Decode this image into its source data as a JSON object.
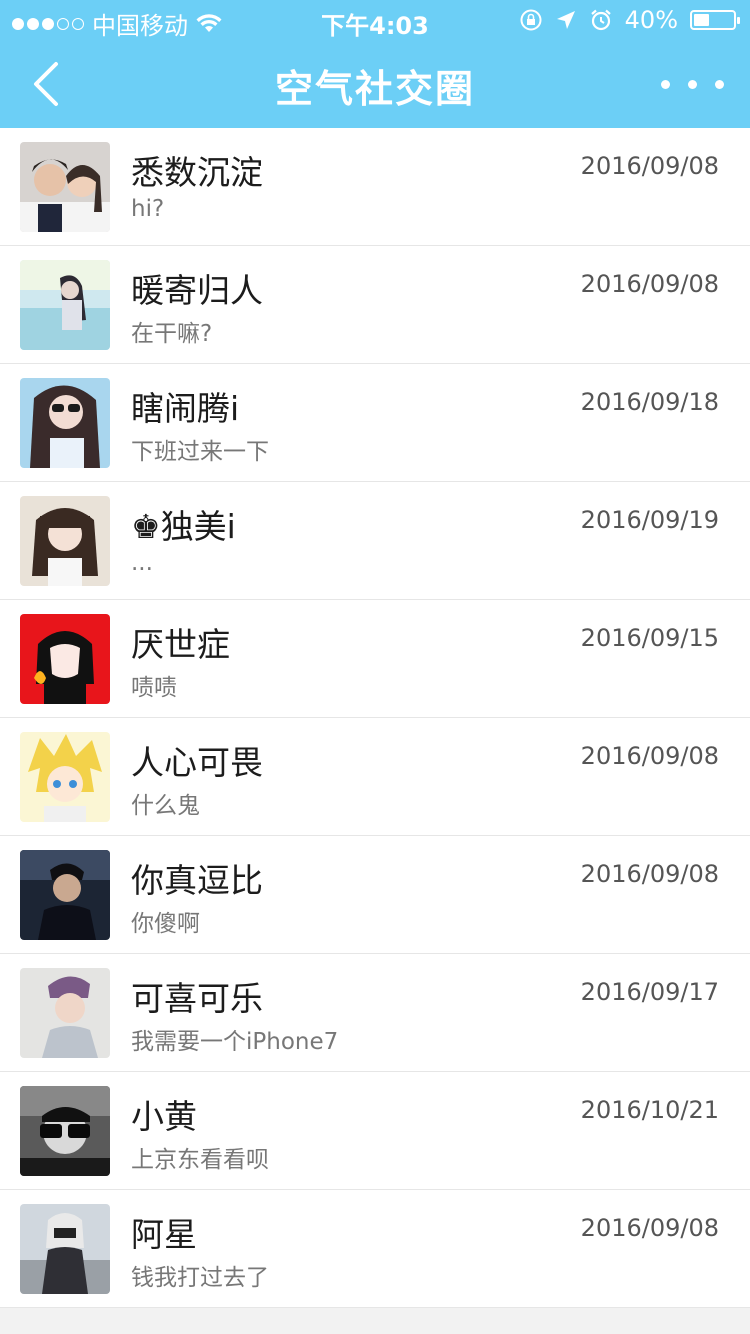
{
  "status_bar": {
    "carrier": "中国移动",
    "time": "下午4:03",
    "battery": "40%",
    "battery_level": 0.4,
    "signal_bars": 3,
    "signal_total": 5
  },
  "nav": {
    "title": "空气社交圈",
    "background_color": "#6ccff6"
  },
  "chats": [
    {
      "name": "悉数沉淀",
      "message": "hi?",
      "date": "2016/09/08"
    },
    {
      "name": "暖寄归人",
      "message": "在干嘛?",
      "date": "2016/09/08"
    },
    {
      "name": "瞎闹腾i",
      "message": "下班过来一下",
      "date": "2016/09/18"
    },
    {
      "name": "♚独美i",
      "message": "...",
      "date": "2016/09/19"
    },
    {
      "name": "厌世症",
      "message": "啧啧",
      "date": "2016/09/15"
    },
    {
      "name": "人心可畏",
      "message": "什么鬼",
      "date": "2016/09/08"
    },
    {
      "name": "你真逗比",
      "message": "你傻啊",
      "date": "2016/09/08"
    },
    {
      "name": "可喜可乐",
      "message": "我需要一个iPhone7",
      "date": "2016/09/17"
    },
    {
      "name": "小黄",
      "message": "上京东看看呗",
      "date": "2016/10/21"
    },
    {
      "name": "阿星",
      "message": "钱我打过去了",
      "date": "2016/09/08"
    }
  ]
}
